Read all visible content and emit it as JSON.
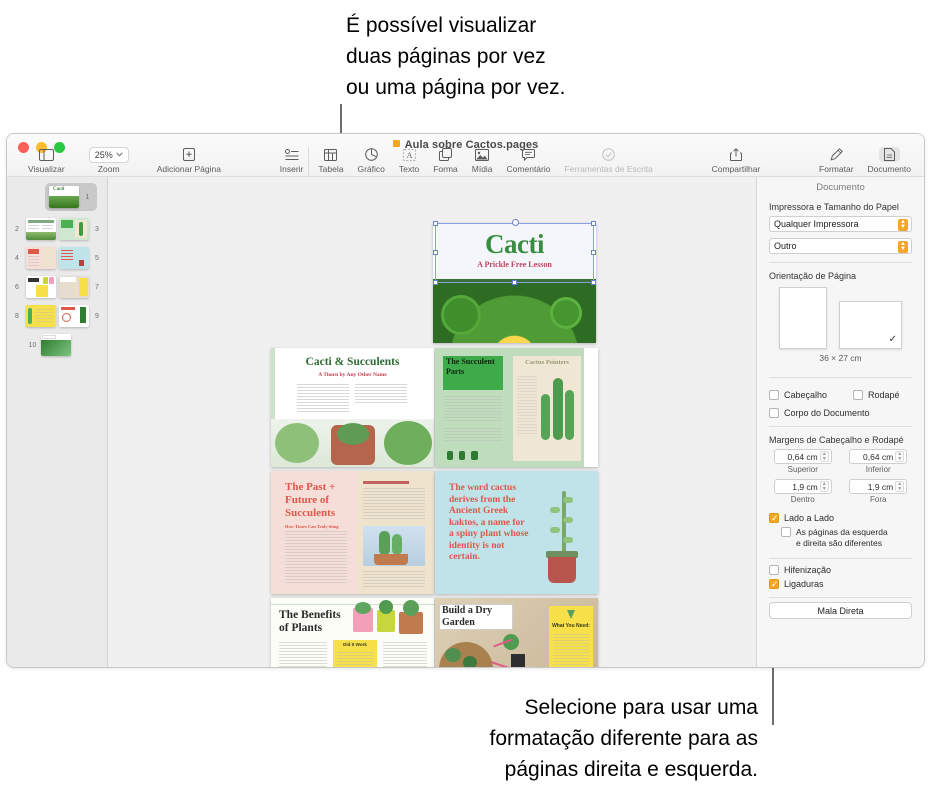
{
  "callouts": {
    "top": "É possível visualizar\nduas páginas por vez\nou uma página por vez.",
    "bottom": "Selecione para usar uma\nformatação diferente para as\npáginas direita e esquerda."
  },
  "window": {
    "title": "Aula sobre Cactos.pages",
    "traffic_lights": [
      "close",
      "minimize",
      "zoom"
    ]
  },
  "toolbar": {
    "items": [
      {
        "label": "Visualizar",
        "icon": "sidebar-icon",
        "dim": false
      },
      {
        "label": "Zoom",
        "icon": "zoom-percent",
        "dim": false
      },
      {
        "label": "Adicionar Página",
        "icon": "add-page-icon",
        "dim": false
      },
      {
        "label": "Inserir",
        "icon": "insert-icon",
        "dim": false
      },
      {
        "label": "Tabela",
        "icon": "table-icon",
        "dim": false
      },
      {
        "label": "Gráfico",
        "icon": "chart-icon",
        "dim": false
      },
      {
        "label": "Texto",
        "icon": "text-icon",
        "dim": false
      },
      {
        "label": "Forma",
        "icon": "shape-icon",
        "dim": false
      },
      {
        "label": "Mídia",
        "icon": "media-icon",
        "dim": false
      },
      {
        "label": "Comentário",
        "icon": "comment-icon",
        "dim": false
      },
      {
        "label": "Ferramentas de Escrita",
        "icon": "writing-tools-icon",
        "dim": true
      },
      {
        "label": "Compartilhar",
        "icon": "share-icon",
        "dim": false
      },
      {
        "label": "Formatar",
        "icon": "format-brush-icon",
        "dim": false
      },
      {
        "label": "Documento",
        "icon": "document-icon",
        "dim": false
      }
    ],
    "zoom_value": "25%"
  },
  "thumbnails": {
    "selected": "1",
    "rows": [
      {
        "numbers": [
          "1"
        ],
        "pages": [
          "p1"
        ]
      },
      {
        "numbers": [
          "2",
          "3"
        ],
        "pages": [
          "p2",
          "p3"
        ]
      },
      {
        "numbers": [
          "4",
          "5"
        ],
        "pages": [
          "p4",
          "p5"
        ]
      },
      {
        "numbers": [
          "6",
          "7"
        ],
        "pages": [
          "p6",
          "p7"
        ]
      },
      {
        "numbers": [
          "8",
          "9"
        ],
        "pages": [
          "p8",
          "p9"
        ]
      },
      {
        "numbers": [
          "10"
        ],
        "pages": [
          "p10"
        ]
      }
    ]
  },
  "canvas": {
    "pages": [
      {
        "id": "p1",
        "title": "Cacti",
        "subtitle": "A Prickle Free Lesson",
        "selected": true
      },
      {
        "id": "p2",
        "title": "Cacti & Succulents",
        "subtitle": "A Thorn by Any Other Name"
      },
      {
        "id": "p3",
        "title": "The Succulent Parts",
        "subtitle": "Cactus Pointers"
      },
      {
        "id": "p4",
        "title": "The Past + Future of Succulents",
        "subtitle": "How Times Can Truly Sting"
      },
      {
        "id": "p5",
        "title": "The word cactus derives from the Ancient Greek kaktos, a name for a spiny plant whose identity is not certain."
      },
      {
        "id": "p6",
        "title": "The Benefits of Plants",
        "subtitle": "Did It Work"
      },
      {
        "id": "p7",
        "title": "Build a Dry Garden",
        "subtitle": "What You Need:"
      }
    ]
  },
  "inspector": {
    "title": "Documento",
    "printer_section_label": "Impressora e Tamanho do Papel",
    "printer_value": "Qualquer Impressora",
    "paper_value": "Outro",
    "orientation_label": "Orientação de Página",
    "orientation_selected": "landscape",
    "paper_size": "36 × 27 cm",
    "checkboxes_top": [
      {
        "label": "Cabeçalho",
        "checked": false
      },
      {
        "label": "Rodapé",
        "checked": false
      },
      {
        "label": "Corpo do Documento",
        "checked": false
      }
    ],
    "margins_label": "Margens de Cabeçalho e Rodapé",
    "margins": [
      {
        "value": "0,64 cm",
        "caption": "Superior"
      },
      {
        "value": "0,64 cm",
        "caption": "Inferior"
      },
      {
        "value": "1,9 cm",
        "caption": "Dentro"
      },
      {
        "value": "1,9 cm",
        "caption": "Fora"
      }
    ],
    "side_by_side": {
      "label": "Lado a Lado",
      "checked": true
    },
    "left_right_different": {
      "label": "As páginas da esquerda\ne direita são diferentes",
      "checked": false
    },
    "hyphenation": {
      "label": "Hifenização",
      "checked": false
    },
    "ligatures": {
      "label": "Ligaduras",
      "checked": true
    },
    "mail_merge_button": "Mala Direta"
  },
  "colors": {
    "accent": "#f5a623",
    "canvas_bg": "#f0f0f0",
    "sidebar_bg": "#eaeaea",
    "inspector_bg": "#f6f6f6",
    "leader": "#6e6e6e"
  }
}
